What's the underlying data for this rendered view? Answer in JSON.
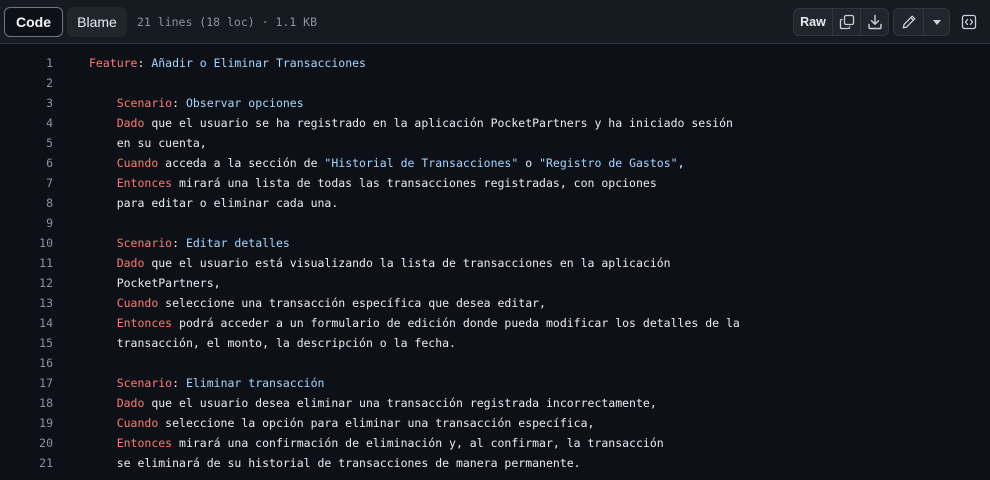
{
  "toolbar": {
    "code_label": "Code",
    "blame_label": "Blame",
    "file_meta": "21 lines (18 loc) · 1.1 KB",
    "raw_label": "Raw",
    "icons": {
      "copy": "copy-icon",
      "download": "download-icon",
      "edit": "pencil-icon",
      "more": "triangle-down-icon",
      "symbols": "code-square-icon"
    }
  },
  "colors": {
    "background": "#0d1117",
    "keyword": "#ff7b72",
    "title": "#a5d6ff",
    "text": "#e6edf3",
    "line_number": "#8b949e"
  },
  "code": {
    "lines": [
      {
        "n": "1",
        "indent": "",
        "kw": "Feature",
        "sep": ": ",
        "rest": "",
        "title": "Añadir o Eliminar Transacciones"
      },
      {
        "n": "2",
        "indent": "",
        "kw": "",
        "sep": "",
        "rest": "",
        "title": ""
      },
      {
        "n": "3",
        "indent": "    ",
        "kw": "Scenario",
        "sep": ": ",
        "rest": "",
        "title": "Observar opciones"
      },
      {
        "n": "4",
        "indent": "    ",
        "kw": "Dado",
        "sep": "",
        "rest": " que el usuario se ha registrado en la aplicación PocketPartners y ha iniciado sesión",
        "title": ""
      },
      {
        "n": "5",
        "indent": "    ",
        "kw": "",
        "sep": "",
        "rest": "en su cuenta,",
        "title": ""
      },
      {
        "n": "6",
        "indent": "    ",
        "kw": "Cuando",
        "sep": "",
        "rest": " acceda a la sección de ",
        "str1": "\"Historial de Transacciones\"",
        "mid": " o ",
        "str2": "\"Registro de Gastos\"",
        "tail": ",",
        "title": ""
      },
      {
        "n": "7",
        "indent": "    ",
        "kw": "Entonces",
        "sep": "",
        "rest": " mirará una lista de todas las transacciones registradas, con opciones",
        "title": ""
      },
      {
        "n": "8",
        "indent": "    ",
        "kw": "",
        "sep": "",
        "rest": "para editar o eliminar cada una.",
        "title": ""
      },
      {
        "n": "9",
        "indent": "",
        "kw": "",
        "sep": "",
        "rest": "",
        "title": ""
      },
      {
        "n": "10",
        "indent": "    ",
        "kw": "Scenario",
        "sep": ": ",
        "rest": "",
        "title": "Editar detalles"
      },
      {
        "n": "11",
        "indent": "    ",
        "kw": "Dado",
        "sep": "",
        "rest": " que el usuario está visualizando la lista de transacciones en la aplicación",
        "title": ""
      },
      {
        "n": "12",
        "indent": "    ",
        "kw": "",
        "sep": "",
        "rest": "PocketPartners,",
        "title": ""
      },
      {
        "n": "13",
        "indent": "    ",
        "kw": "Cuando",
        "sep": "",
        "rest": " seleccione una transacción específica que desea editar,",
        "title": ""
      },
      {
        "n": "14",
        "indent": "    ",
        "kw": "Entonces",
        "sep": "",
        "rest": " podrá acceder a un formulario de edición donde pueda modificar los detalles de la",
        "title": ""
      },
      {
        "n": "15",
        "indent": "    ",
        "kw": "",
        "sep": "",
        "rest": "transacción, el monto, la descripción o la fecha.",
        "title": ""
      },
      {
        "n": "16",
        "indent": "",
        "kw": "",
        "sep": "",
        "rest": "",
        "title": ""
      },
      {
        "n": "17",
        "indent": "    ",
        "kw": "Scenario",
        "sep": ": ",
        "rest": "",
        "title": "Eliminar transacción"
      },
      {
        "n": "18",
        "indent": "    ",
        "kw": "Dado",
        "sep": "",
        "rest": " que el usuario desea eliminar una transacción registrada incorrectamente,",
        "title": ""
      },
      {
        "n": "19",
        "indent": "    ",
        "kw": "Cuando",
        "sep": "",
        "rest": " seleccione la opción para eliminar una transacción específica,",
        "title": ""
      },
      {
        "n": "20",
        "indent": "    ",
        "kw": "Entonces",
        "sep": "",
        "rest": " mirará una confirmación de eliminación y, al confirmar, la transacción",
        "title": ""
      },
      {
        "n": "21",
        "indent": "    ",
        "kw": "",
        "sep": "",
        "rest": "se eliminará de su historial de transacciones de manera permanente.",
        "title": ""
      }
    ]
  }
}
